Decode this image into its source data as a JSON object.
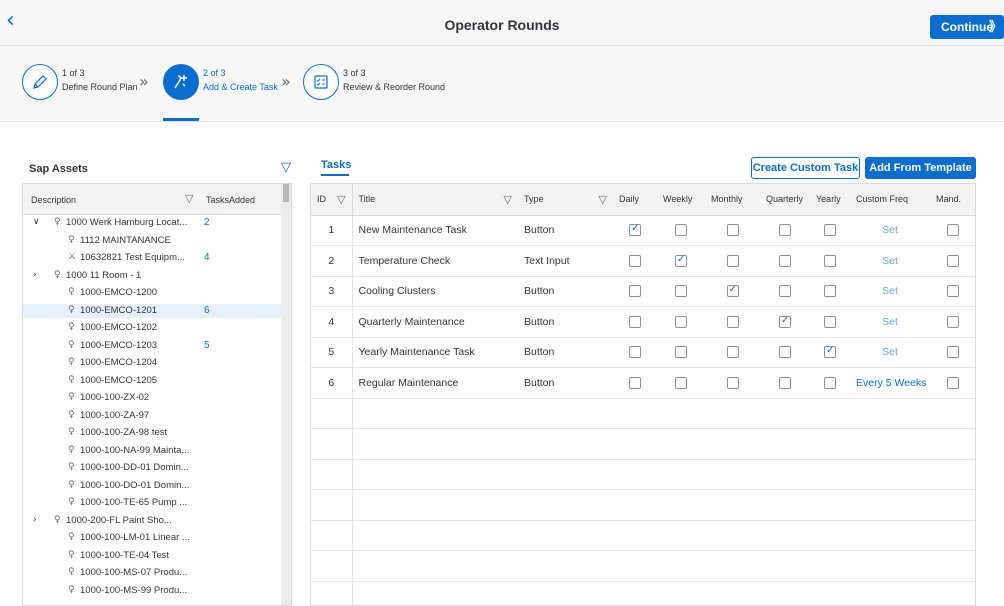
{
  "header": {
    "back_icon": "back-chevron-icon",
    "title": "Operator Rounds",
    "continue_label": "Continue"
  },
  "steps": [
    {
      "num": "1 of 3",
      "label": "Define Round Plan",
      "icon": "pencil-icon"
    },
    {
      "num": "2 of 3",
      "label": "Add & Create Task",
      "icon": "add-task-icon",
      "active": true
    },
    {
      "num": "3 of 3",
      "label": "Review & Reorder Round",
      "icon": "checklist-icon"
    }
  ],
  "assets": {
    "title": "Sap Assets",
    "columns": {
      "description": "Description",
      "tasks_added": "TasksAdded"
    },
    "rows": [
      {
        "label": "1000 Werk Hamburg Locat...",
        "count": "2",
        "expanded": true,
        "level": 0
      },
      {
        "label": "1112 MAINTANANCE",
        "count": "",
        "level": 1
      },
      {
        "label": "10632821 Test Equipm...",
        "count": "4",
        "level": 1,
        "icon": "equipment-icon"
      },
      {
        "label": "1000 11 Room - 1",
        "count": "",
        "level": 0,
        "collapsed": true
      },
      {
        "label": "1000-EMCO-1200",
        "count": "",
        "level": 1
      },
      {
        "label": "1000-EMCO-1201",
        "count": "6",
        "level": 1,
        "selected": true
      },
      {
        "label": "1000-EMCO-1202",
        "count": "",
        "level": 1
      },
      {
        "label": "1000-EMCO-1203",
        "count": "5",
        "level": 1
      },
      {
        "label": "1000-EMCO-1204",
        "count": "",
        "level": 1
      },
      {
        "label": "1000-EMCO-1205",
        "count": "",
        "level": 1
      },
      {
        "label": "1000-100-ZX-02",
        "count": "",
        "level": 1
      },
      {
        "label": "1000-100-ZA-97",
        "count": "",
        "level": 1
      },
      {
        "label": "1000-100-ZA-98 test",
        "count": "",
        "level": 1
      },
      {
        "label": "1000-100-NA-99 Mainta...",
        "count": "",
        "level": 1
      },
      {
        "label": "1000-100-DD-01 Domin...",
        "count": "",
        "level": 1
      },
      {
        "label": "1000-100-DO-01 Domin...",
        "count": "",
        "level": 1
      },
      {
        "label": "1000-100-TE-65 Pump ...",
        "count": "",
        "level": 1
      },
      {
        "label": "1000-200-FL Paint Sho...",
        "count": "",
        "level": 0,
        "collapsed": true
      },
      {
        "label": "1000-100-LM-01 Linear ...",
        "count": "",
        "level": 1
      },
      {
        "label": "1000-100-TE-04 Test",
        "count": "",
        "level": 1
      },
      {
        "label": "1000-100-MS-07 Produ...",
        "count": "",
        "level": 1
      },
      {
        "label": "1000-100-MS-99 Produ...",
        "count": "",
        "level": 1
      }
    ]
  },
  "tasks": {
    "tab_label": "Tasks",
    "create_custom_label": "Create Custom Task",
    "add_template_label": "Add From Template",
    "columns": [
      "ID",
      "Title",
      "Type",
      "Daily",
      "Weekly",
      "Monthly",
      "Quarterly",
      "Yearly",
      "Custom Freq",
      "Mand."
    ],
    "rows": [
      {
        "id": "1",
        "title": "New Maintenance Task",
        "type": "Button",
        "freq": [
          true,
          false,
          false,
          false,
          false
        ],
        "custom": "Set",
        "mand": false
      },
      {
        "id": "2",
        "title": "Temperature Check",
        "type": "Text Input",
        "freq": [
          false,
          true,
          false,
          false,
          false
        ],
        "custom": "Set",
        "mand": false
      },
      {
        "id": "3",
        "title": "Cooling Clusters",
        "type": "Button",
        "freq": [
          false,
          false,
          true,
          false,
          false
        ],
        "custom": "Set",
        "mand": false
      },
      {
        "id": "4",
        "title": "Quarterly Maintenance",
        "type": "Button",
        "freq": [
          false,
          false,
          false,
          true,
          false
        ],
        "custom": "Set",
        "mand": false
      },
      {
        "id": "5",
        "title": "Yearly Maintenance Task",
        "type": "Button",
        "freq": [
          false,
          false,
          false,
          false,
          true
        ],
        "custom": "Set",
        "mand": false
      },
      {
        "id": "6",
        "title": "Regular Maintenance",
        "type": "Button",
        "freq": [
          false,
          false,
          false,
          false,
          false
        ],
        "custom": "Every 5 Weeks",
        "mand": false
      }
    ],
    "empty_rows": 7
  }
}
